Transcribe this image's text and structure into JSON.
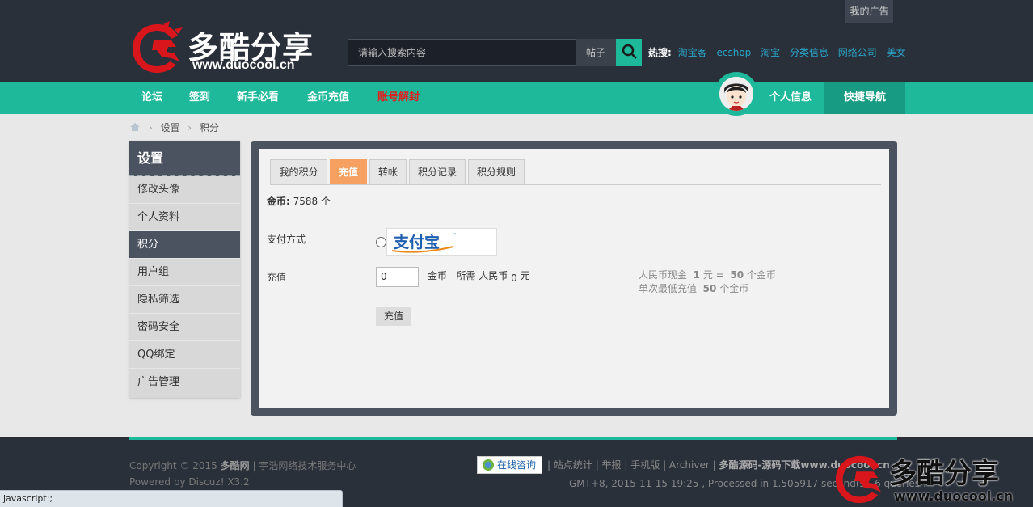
{
  "header": {
    "ad_label": "我的广告",
    "logo": {
      "name_cn": "多酷分享",
      "url_text": "www.duocool.cn"
    },
    "search": {
      "placeholder": "请输入搜索内容",
      "type_label": "帖子"
    },
    "hot": {
      "label": "热搜:",
      "links": [
        "淘宝客",
        "ecshop",
        "淘宝",
        "分类信息",
        "网络公司",
        "美女"
      ]
    }
  },
  "nav": {
    "items": [
      "论坛",
      "签到",
      "新手必看",
      "金币充值",
      "账号解封"
    ],
    "profile_label": "个人信息",
    "quick_nav_label": "快捷导航"
  },
  "breadcrumb": [
    "设置",
    "积分"
  ],
  "sidebar": {
    "title": "设置",
    "items": [
      "修改头像",
      "个人资料",
      "积分",
      "用户组",
      "隐私筛选",
      "密码安全",
      "QQ绑定",
      "广告管理"
    ],
    "active_index": 2
  },
  "main": {
    "tabs": [
      "我的积分",
      "充值",
      "转帐",
      "积分记录",
      "积分规则"
    ],
    "active_tab": 1,
    "gold_label": "金币:",
    "gold_value": "7588 个",
    "pay_method_label": "支付方式",
    "alipay_text": "支付宝",
    "recharge_label": "充值",
    "amount_value": "0",
    "amount_unit": "金币",
    "need_label": "所需 人民币",
    "need_value": "0",
    "need_unit": "元",
    "rate_line1": {
      "prefix": "人民币现金",
      "rmb": "1",
      "mid": "元 =",
      "gold": "50",
      "suffix": "个金币"
    },
    "rate_line2": {
      "prefix": "单次最低充值",
      "gold": "50",
      "suffix": "个金币"
    },
    "submit_label": "充值"
  },
  "footer": {
    "copyright_prefix": "Copyright © 2015",
    "site_name": "多酷网",
    "company": "| 宇浩网络技术服务中心",
    "powered": "Powered by Discuz! X3.2",
    "consult_label": "在线咨询",
    "links": [
      "站点统计",
      "举报",
      "手机版",
      "Archiver"
    ],
    "bold_link": "多酷源码-源码下载www.duocool.cn",
    "gmt_text": "GMT+8, 2015-11-15 19:25 , Processed in 1.505917 second(s), 6 queries ."
  },
  "watermark": {
    "name_cn": "多酷分享",
    "url_text": "www.duocool.cn"
  },
  "status_bar": "javascript:;",
  "colors": {
    "teal": "#1eb89a",
    "dark": "#2a303a",
    "orange_tab": "#f6a061",
    "red_nav": "#e02020",
    "link_blue": "#2aa4c8"
  }
}
